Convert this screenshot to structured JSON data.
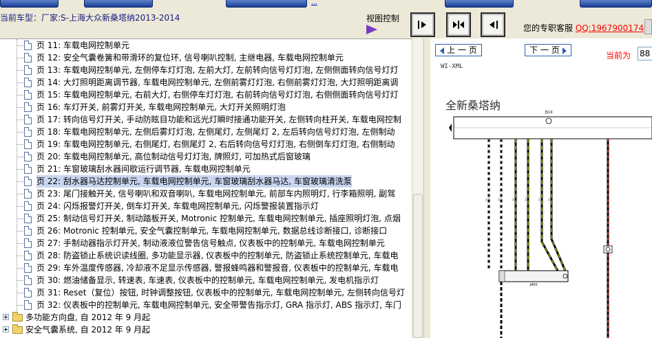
{
  "top_buttons": [
    "",
    "",
    "",
    "",
    ""
  ],
  "top_link": "...",
  "header": {
    "vehicle": "当前车型：厂家:S-上海大众新桑塔纳2013-2014",
    "view_control": "视图控制",
    "support_text": "您的专职客服",
    "support_qq": "QQ:1967900174"
  },
  "tree": {
    "pages": [
      {
        "prefix": "页",
        "num": "11:",
        "text": "车载电网控制单元"
      },
      {
        "prefix": "页",
        "num": "12:",
        "text": "安全气囊卷簧和带滑环的复位环, 信号喇叭控制, 主继电器, 车载电网控制单元"
      },
      {
        "prefix": "页",
        "num": "13:",
        "text": "车载电网控制单元, 左侧停车灯灯泡, 左前大灯, 左前转向信号灯灯泡, 左侧侧面转向信号灯灯"
      },
      {
        "prefix": "页",
        "num": "14:",
        "text": "大灯照明距离调节器, 车载电网控制单元, 左侧前雾灯灯泡, 右侧前雾灯灯泡, 大灯照明距离调"
      },
      {
        "prefix": "页",
        "num": "15:",
        "text": "车载电网控制单元, 右前大灯, 右侧停车灯灯泡, 右前转向信号灯灯泡, 右侧侧面转向信号灯灯"
      },
      {
        "prefix": "页",
        "num": "16:",
        "text": "车灯开关, 前雾灯开关, 车载电网控制单元, 大灯开关照明灯泡"
      },
      {
        "prefix": "页",
        "num": "17:",
        "text": "转向信号灯开关, 手动防眩目功能和远光灯瞬时接通功能开关, 左侧转向柱开关, 车载电网控制"
      },
      {
        "prefix": "页",
        "num": "18:",
        "text": "车载电网控制单元, 左侧后雾灯灯泡, 左侧尾灯, 左侧尾灯 2, 左后转向信号灯灯泡, 左侧制动"
      },
      {
        "prefix": "页",
        "num": "19:",
        "text": "车载电网控制单元, 右侧尾灯, 右侧尾灯 2, 右后转向信号灯灯泡, 右侧倒车灯灯泡, 右侧制动"
      },
      {
        "prefix": "页",
        "num": "20:",
        "text": "车载电网控制单元, 高位制动信号灯灯泡, 牌照灯, 可加热式后窗玻璃"
      },
      {
        "prefix": "页",
        "num": "21:",
        "text": "车窗玻璃刮水器间歇运行调节器, 车载电网控制单元"
      },
      {
        "prefix": "页",
        "num": "22:",
        "text": "刮水器马达控制单元, 车载电网控制单元, 车窗玻璃刮水器马达, 车窗玻璃清洗泵"
      },
      {
        "prefix": "页",
        "num": "23:",
        "text": "尾门接触开关, 信号喇叭和双音喇叭, 车载电网控制单元, 前部车内照明灯, 行李箱照明, 副驾"
      },
      {
        "prefix": "页",
        "num": "24:",
        "text": "闪烁报警灯开关, 倒车灯开关, 车载电网控制单元, 闪烁警报装置指示灯"
      },
      {
        "prefix": "页",
        "num": "25:",
        "text": "制动信号灯开关, 制动踏板开关, Motronic 控制单元, 车载电网控制单元, 插座照明灯泡, 点烟"
      },
      {
        "prefix": "页",
        "num": "26:",
        "text": "Motronic 控制单元, 安全气囊控制单元, 车载电网控制单元, 数据总线诊断接口, 诊断接口"
      },
      {
        "prefix": "页",
        "num": "27:",
        "text": "手制动器指示灯开关, 制动液液位警告信号触点, 仪表板中的控制单元, 车载电网控制单元"
      },
      {
        "prefix": "页",
        "num": "28:",
        "text": "防盗锁止系统识读线圈, 多功能显示器, 仪表板中的控制单元, 防盗锁止系统控制单元, 车载电"
      },
      {
        "prefix": "页",
        "num": "29:",
        "text": "车外温度传感器, 冷却液不足显示传感器, 警报蜂鸣器和警报音, 仪表板中的控制单元, 车载电"
      },
      {
        "prefix": "页",
        "num": "30:",
        "text": "燃油储备显示, 转速表, 车速表, 仪表板中的控制单元, 车载电网控制单元, 发电机指示灯"
      },
      {
        "prefix": "页",
        "num": "31:",
        "text": "Reset（复位）按钮, 时钟调整按钮, 仪表板中的控制单元, 车载电网控制单元, 左侧转向信号灯"
      },
      {
        "prefix": "页",
        "num": "32:",
        "text": "仪表板中的控制单元, 车载电网控制单元, 安全带警告指示灯, GRA 指示灯, ABS 指示灯, 车门"
      }
    ],
    "selected_index": 11,
    "folders": [
      {
        "text": "多功能方向盘, 自 2012 年 9 月起"
      },
      {
        "text": "安全气囊系统, 自 2012 年 9 月起"
      }
    ]
  },
  "viewer": {
    "prev_label": "上 一 页",
    "next_label": "下 一 页",
    "current_label": "当前为",
    "current_page": "88",
    "doc_code": "WI-XML",
    "doc_title": "全新桑塔纳",
    "top_connector_label": "J519",
    "mid_connector_label": "J400"
  },
  "colors": {
    "selection": "#c9d6ef",
    "accent_red": "#ff0000",
    "arrow_purple": "#7a3cc2",
    "nav_border": "#2c5fb3"
  }
}
